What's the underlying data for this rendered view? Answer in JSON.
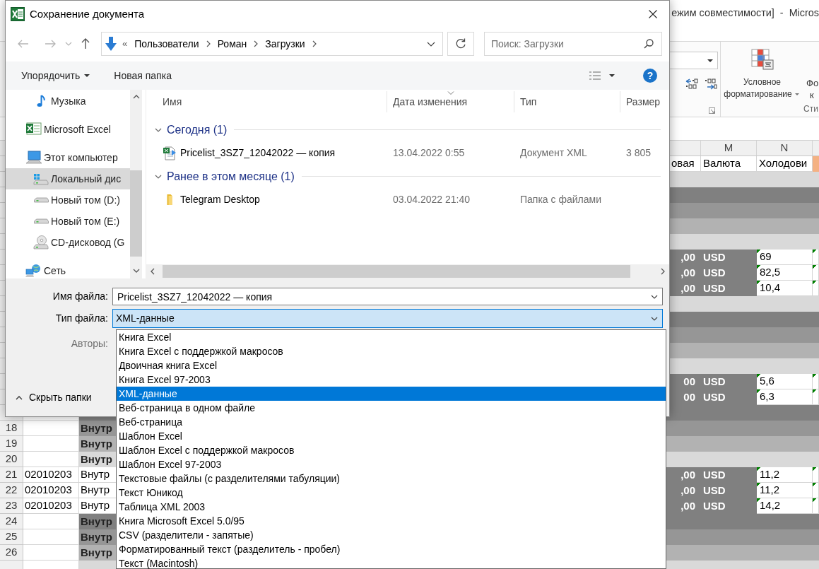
{
  "excel": {
    "title": "ежим совместимости]  -  Micros",
    "ribbon": {
      "conditional_format": "Условное форматирование",
      "next_button": [
        "Фо",
        "к"
      ],
      "group_label": "Сти"
    },
    "sheet": {
      "column_headers": [
        "M",
        "N"
      ],
      "rows": [
        {
          "kind": "header",
          "l": "овая",
          "m": "Валюта",
          "n": "Холодови"
        },
        {
          "kind": "light"
        },
        {
          "kind": "dark"
        },
        {
          "kind": "mid"
        },
        {
          "kind": "pale"
        },
        {
          "kind": "light"
        },
        {
          "kind": "data",
          "l": ",00",
          "m": "USD",
          "n": "69"
        },
        {
          "kind": "data",
          "l": ",00",
          "m": "USD",
          "n": "82,5"
        },
        {
          "kind": "data",
          "l": ",00",
          "m": "USD",
          "n": "10,4"
        },
        {
          "kind": "light"
        },
        {
          "kind": "dark"
        },
        {
          "kind": "mid"
        },
        {
          "kind": "pale"
        },
        {
          "kind": "light"
        },
        {
          "kind": "data",
          "l": "00",
          "m": "USD",
          "n": "5,6"
        },
        {
          "kind": "data",
          "l": "00",
          "m": "USD",
          "n": "6,3"
        },
        {
          "kind": "dark"
        },
        {
          "kind": "mid",
          "number": "18",
          "b": "Внутр"
        },
        {
          "kind": "pale",
          "number": "19",
          "b": "Внутр"
        },
        {
          "kind": "light",
          "number": "20",
          "b": "Внутр"
        },
        {
          "kind": "data",
          "number": "21",
          "a": "02010203",
          "b": "Внутр",
          "l": ",00",
          "m": "USD",
          "n": "11,2"
        },
        {
          "kind": "data",
          "number": "22",
          "a": "02010203",
          "b": "Внутр",
          "l": ",00",
          "m": "USD",
          "n": "11,2"
        },
        {
          "kind": "data",
          "number": "23",
          "a": "02010203",
          "b": "Внутр",
          "l": ",00",
          "m": "USD",
          "n": "14,2"
        },
        {
          "kind": "dark",
          "number": "24",
          "b": "Внутр"
        },
        {
          "kind": "mid",
          "number": "25",
          "b": "Внутр"
        },
        {
          "kind": "pale",
          "number": "26",
          "b": "Внутр"
        },
        {
          "kind": "light"
        }
      ]
    }
  },
  "dialog": {
    "title": "Сохранение документа",
    "address": {
      "overflow": "«",
      "breadcrumb": [
        "Пользователи",
        "Роман",
        "Загрузки"
      ]
    },
    "search": {
      "placeholder": "Поиск: Загрузки"
    },
    "toolbar": {
      "organize": "Упорядочить",
      "new_folder": "Новая папка",
      "help": "?"
    },
    "nav": [
      {
        "label": "Музыка",
        "kind": "music",
        "selected": false
      },
      {
        "label": "Microsoft Excel",
        "kind": "app",
        "selected": false
      },
      {
        "label": "Этот компьютер",
        "kind": "computer",
        "selected": false,
        "children": [
          {
            "label": "Локальный дис",
            "kind": "system-drive",
            "selected": true
          },
          {
            "label": "Новый том (D:)",
            "kind": "drive",
            "selected": false
          },
          {
            "label": "Новый том (E:)",
            "kind": "drive",
            "selected": false
          },
          {
            "label": "CD-дисковод (G",
            "kind": "cd",
            "selected": false
          }
        ]
      },
      {
        "label": "Сеть",
        "kind": "network",
        "selected": false
      }
    ],
    "columns": [
      "Имя",
      "Дата изменения",
      "Тип",
      "Размер"
    ],
    "groups": [
      {
        "title": "Сегодня (1)",
        "expanded": true,
        "items": [
          {
            "name": "Pricelist_3SZ7_12042022 — копия",
            "kind": "xml",
            "date": "13.04.2022 0:55",
            "type": "Документ XML",
            "size": "3 805"
          }
        ]
      },
      {
        "title": "Ранее в этом месяце (1)",
        "expanded": true,
        "items": [
          {
            "name": "Telegram Desktop",
            "kind": "folder",
            "date": "03.04.2022 21:40",
            "type": "Папка с файлами"
          }
        ]
      }
    ],
    "filename": {
      "label": "Имя файла:",
      "value": "Pricelist_3SZ7_12042022 — копия"
    },
    "filetype": {
      "label": "Тип файла:",
      "value": "XML-данные",
      "expanded": true,
      "options": [
        {
          "label": "Книга Excel",
          "selected": false
        },
        {
          "label": "Книга Excel с поддержкой макросов",
          "selected": false
        },
        {
          "label": "Двоичная книга Excel",
          "selected": false
        },
        {
          "label": "Книга Excel 97-2003",
          "selected": false
        },
        {
          "label": "XML-данные",
          "selected": true
        },
        {
          "label": "Веб-страница в одном файле",
          "selected": false
        },
        {
          "label": "Веб-страница",
          "selected": false
        },
        {
          "label": "Шаблон Excel",
          "selected": false
        },
        {
          "label": "Шаблон Excel с поддержкой макросов",
          "selected": false
        },
        {
          "label": "Шаблон Excel 97-2003",
          "selected": false
        },
        {
          "label": "Текстовые файлы (с разделителями табуляции)",
          "selected": false
        },
        {
          "label": "Текст Юникод",
          "selected": false
        },
        {
          "label": "Таблица XML 2003",
          "selected": false
        },
        {
          "label": "Книга Microsoft Excel 5.0/95",
          "selected": false
        },
        {
          "label": "CSV (разделители - запятые)",
          "selected": false
        },
        {
          "label": "Форматированный текст (разделитель - пробел)",
          "selected": false
        },
        {
          "label": "Текст (Macintosh)",
          "selected": false
        }
      ]
    },
    "authors": {
      "label": "Авторы:"
    },
    "hide_folders": "Скрыть папки"
  }
}
